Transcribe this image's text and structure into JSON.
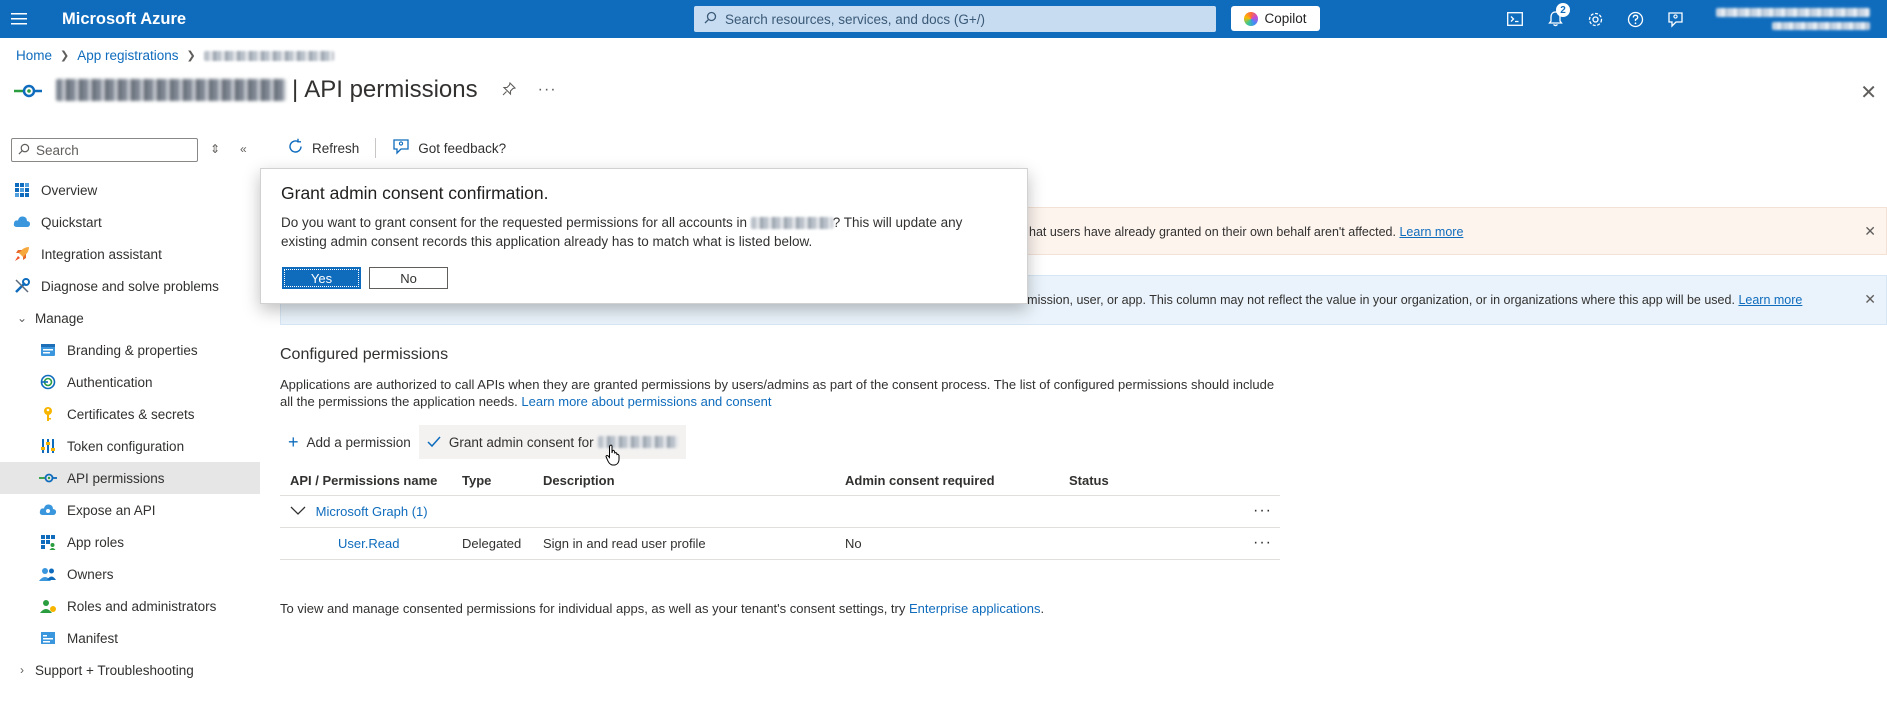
{
  "topbar": {
    "brand": "Microsoft Azure",
    "search_placeholder": "Search resources, services, and docs (G+/)",
    "copilot_label": "Copilot",
    "notification_count": "2",
    "color": "#0f6cbd"
  },
  "breadcrumb": {
    "home": "Home",
    "app_registrations": "App registrations"
  },
  "page": {
    "title_separator": "|",
    "title": "API permissions",
    "more": "···"
  },
  "leftnav": {
    "search_placeholder": "Search",
    "items": [
      {
        "label": "Overview",
        "icon": "overview-icon"
      },
      {
        "label": "Quickstart",
        "icon": "quickstart-icon"
      },
      {
        "label": "Integration assistant",
        "icon": "rocket-icon"
      },
      {
        "label": "Diagnose and solve problems",
        "icon": "wrench-icon"
      },
      {
        "label": "Manage",
        "icon": "chevron-down-icon"
      },
      {
        "label": "Branding & properties",
        "icon": "branding-icon"
      },
      {
        "label": "Authentication",
        "icon": "authentication-icon"
      },
      {
        "label": "Certificates & secrets",
        "icon": "key-icon"
      },
      {
        "label": "Token configuration",
        "icon": "token-icon"
      },
      {
        "label": "API permissions",
        "icon": "api-permissions-icon"
      },
      {
        "label": "Expose an API",
        "icon": "cloud-icon"
      },
      {
        "label": "App roles",
        "icon": "app-roles-icon"
      },
      {
        "label": "Owners",
        "icon": "owners-icon"
      },
      {
        "label": "Roles and administrators",
        "icon": "roles-icon"
      },
      {
        "label": "Manifest",
        "icon": "manifest-icon"
      },
      {
        "label": "Support + Troubleshooting",
        "icon": "chevron-right-icon"
      }
    ]
  },
  "toolbar": {
    "refresh": "Refresh",
    "feedback": "Got feedback?"
  },
  "banners": {
    "warning_text": "hat users have already granted on their own behalf aren't affected.",
    "warning_link": "Learn more",
    "info_text": "rmission, user, or app. This column may not reflect the value in your organization, or in organizations where this app will be used.",
    "info_link": "Learn more"
  },
  "configured": {
    "title": "Configured permissions",
    "desc_line1": "Applications are authorized to call APIs when they are granted permissions by users/admins as part of the consent process. The list of configured permissions should include",
    "desc_line2": "all the permissions the application needs.",
    "desc_link": "Learn more about permissions and consent",
    "add_permission": "Add a permission",
    "grant_consent": "Grant admin consent for"
  },
  "table": {
    "headers": [
      "API / Permissions name",
      "Type",
      "Description",
      "Admin consent required",
      "Status"
    ],
    "group": "Microsoft Graph (1)",
    "rows": [
      {
        "name": "User.Read",
        "type": "Delegated",
        "description": "Sign in and read user profile",
        "admin": "No",
        "status": ""
      }
    ],
    "more": "···"
  },
  "footnote": {
    "text": "To view and manage consented permissions for individual apps, as well as your tenant's consent settings, try",
    "link": "Enterprise applications",
    "end": "."
  },
  "dialog": {
    "title": "Grant admin consent confirmation.",
    "text_part1": "Do you want to grant consent for the requested permissions for all accounts in",
    "text_part2": "? This will update any existing admin consent records this application already has to match what is listed below.",
    "yes": "Yes",
    "no": "No"
  }
}
